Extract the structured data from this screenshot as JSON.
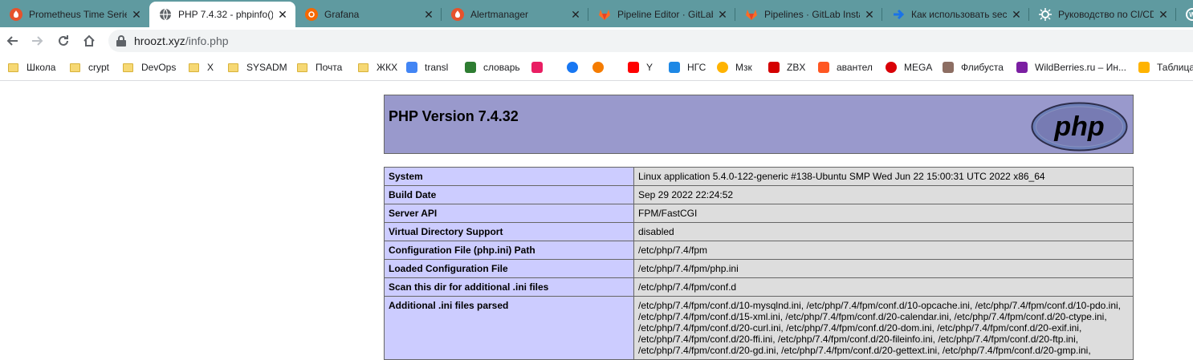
{
  "tabs": [
    {
      "title": "Prometheus Time Series",
      "icon": "prometheus-icon",
      "color": "#e6522c",
      "active": false
    },
    {
      "title": "PHP 7.4.32 - phpinfo()",
      "icon": "globe-icon",
      "color": "#5f6368",
      "active": true
    },
    {
      "title": "Grafana",
      "icon": "grafana-icon",
      "color": "#f46800",
      "active": false
    },
    {
      "title": "Alertmanager",
      "icon": "prometheus-icon",
      "color": "#e6522c",
      "active": false
    },
    {
      "title": "Pipeline Editor · GitLab",
      "icon": "gitlab-icon",
      "color": "#fc6d26",
      "active": false
    },
    {
      "title": "Pipelines · GitLab Insta",
      "icon": "gitlab-icon",
      "color": "#fc6d26",
      "active": false
    },
    {
      "title": "Как использовать sec",
      "icon": "arrow-icon",
      "color": "#1a73e8",
      "active": false
    },
    {
      "title": "Руководство по CI/CD",
      "icon": "gear-icon",
      "color": "#ffffff",
      "active": false
    },
    {
      "title": "",
      "icon": "wordpress-icon",
      "color": "#ffffff",
      "active": false
    }
  ],
  "address": {
    "host": "hroozt.xyz",
    "path": "/info.php"
  },
  "bookmarks": [
    {
      "label": "Школа",
      "type": "folder"
    },
    {
      "label": "crypt",
      "type": "folder"
    },
    {
      "label": "DevOps",
      "type": "folder"
    },
    {
      "label": "X",
      "type": "folder"
    },
    {
      "label": "SYSADM",
      "type": "folder"
    },
    {
      "label": "Почта",
      "type": "folder"
    },
    {
      "label": "ЖКХ",
      "type": "folder"
    },
    {
      "label": "transl",
      "type": "site",
      "icon": "google-translate-icon",
      "color": "#4285f4"
    },
    {
      "label": "словарь",
      "type": "site",
      "icon": "dictionary-icon",
      "color": "#2e7d32"
    },
    {
      "label": "",
      "type": "site",
      "icon": "video-icon",
      "color": "#e91e63"
    },
    {
      "label": "",
      "type": "site",
      "icon": "facebook-icon",
      "color": "#1877f2"
    },
    {
      "label": "",
      "type": "site",
      "icon": "ball-icon",
      "color": "#f57c00"
    },
    {
      "label": "Y",
      "type": "site",
      "icon": "youtube-icon",
      "color": "#ff0000"
    },
    {
      "label": "НГС",
      "type": "site",
      "icon": "wifi-icon",
      "color": "#1e88e5"
    },
    {
      "label": "Мзк",
      "type": "site",
      "icon": "music-icon",
      "color": "#ffb300"
    },
    {
      "label": "ZBX",
      "type": "site",
      "icon": "zabbix-icon",
      "color": "#d40000"
    },
    {
      "label": "авантел",
      "type": "site",
      "icon": "avantel-icon",
      "color": "#ff5722"
    },
    {
      "label": "MEGA",
      "type": "site",
      "icon": "mega-icon",
      "color": "#d90007"
    },
    {
      "label": "Флибуста",
      "type": "site",
      "icon": "flibusta-icon",
      "color": "#8d6e63"
    },
    {
      "label": "WildBerries.ru – Ин...",
      "type": "site",
      "icon": "wildberries-icon",
      "color": "#7b1fa2"
    },
    {
      "label": "Таблица",
      "type": "site",
      "icon": "table-icon",
      "color": "#ffb300"
    }
  ],
  "phpinfo": {
    "title": "PHP Version 7.4.32",
    "logo_text": "php",
    "rows": [
      {
        "key": "System",
        "value": "Linux application 5.4.0-122-generic #138-Ubuntu SMP Wed Jun 22 15:00:31 UTC 2022 x86_64"
      },
      {
        "key": "Build Date",
        "value": "Sep 29 2022 22:24:52"
      },
      {
        "key": "Server API",
        "value": "FPM/FastCGI"
      },
      {
        "key": "Virtual Directory Support",
        "value": "disabled"
      },
      {
        "key": "Configuration File (php.ini) Path",
        "value": "/etc/php/7.4/fpm"
      },
      {
        "key": "Loaded Configuration File",
        "value": "/etc/php/7.4/fpm/php.ini"
      },
      {
        "key": "Scan this dir for additional .ini files",
        "value": "/etc/php/7.4/fpm/conf.d"
      },
      {
        "key": "Additional .ini files parsed",
        "value": "/etc/php/7.4/fpm/conf.d/10-mysqlnd.ini, /etc/php/7.4/fpm/conf.d/10-opcache.ini, /etc/php/7.4/fpm/conf.d/10-pdo.ini, /etc/php/7.4/fpm/conf.d/15-xml.ini, /etc/php/7.4/fpm/conf.d/20-calendar.ini, /etc/php/7.4/fpm/conf.d/20-ctype.ini, /etc/php/7.4/fpm/conf.d/20-curl.ini, /etc/php/7.4/fpm/conf.d/20-dom.ini, /etc/php/7.4/fpm/conf.d/20-exif.ini, /etc/php/7.4/fpm/conf.d/20-ffi.ini, /etc/php/7.4/fpm/conf.d/20-fileinfo.ini, /etc/php/7.4/fpm/conf.d/20-ftp.ini, /etc/php/7.4/fpm/conf.d/20-gd.ini, /etc/php/7.4/fpm/conf.d/20-gettext.ini, /etc/php/7.4/fpm/conf.d/20-gmp.ini,"
      }
    ]
  }
}
